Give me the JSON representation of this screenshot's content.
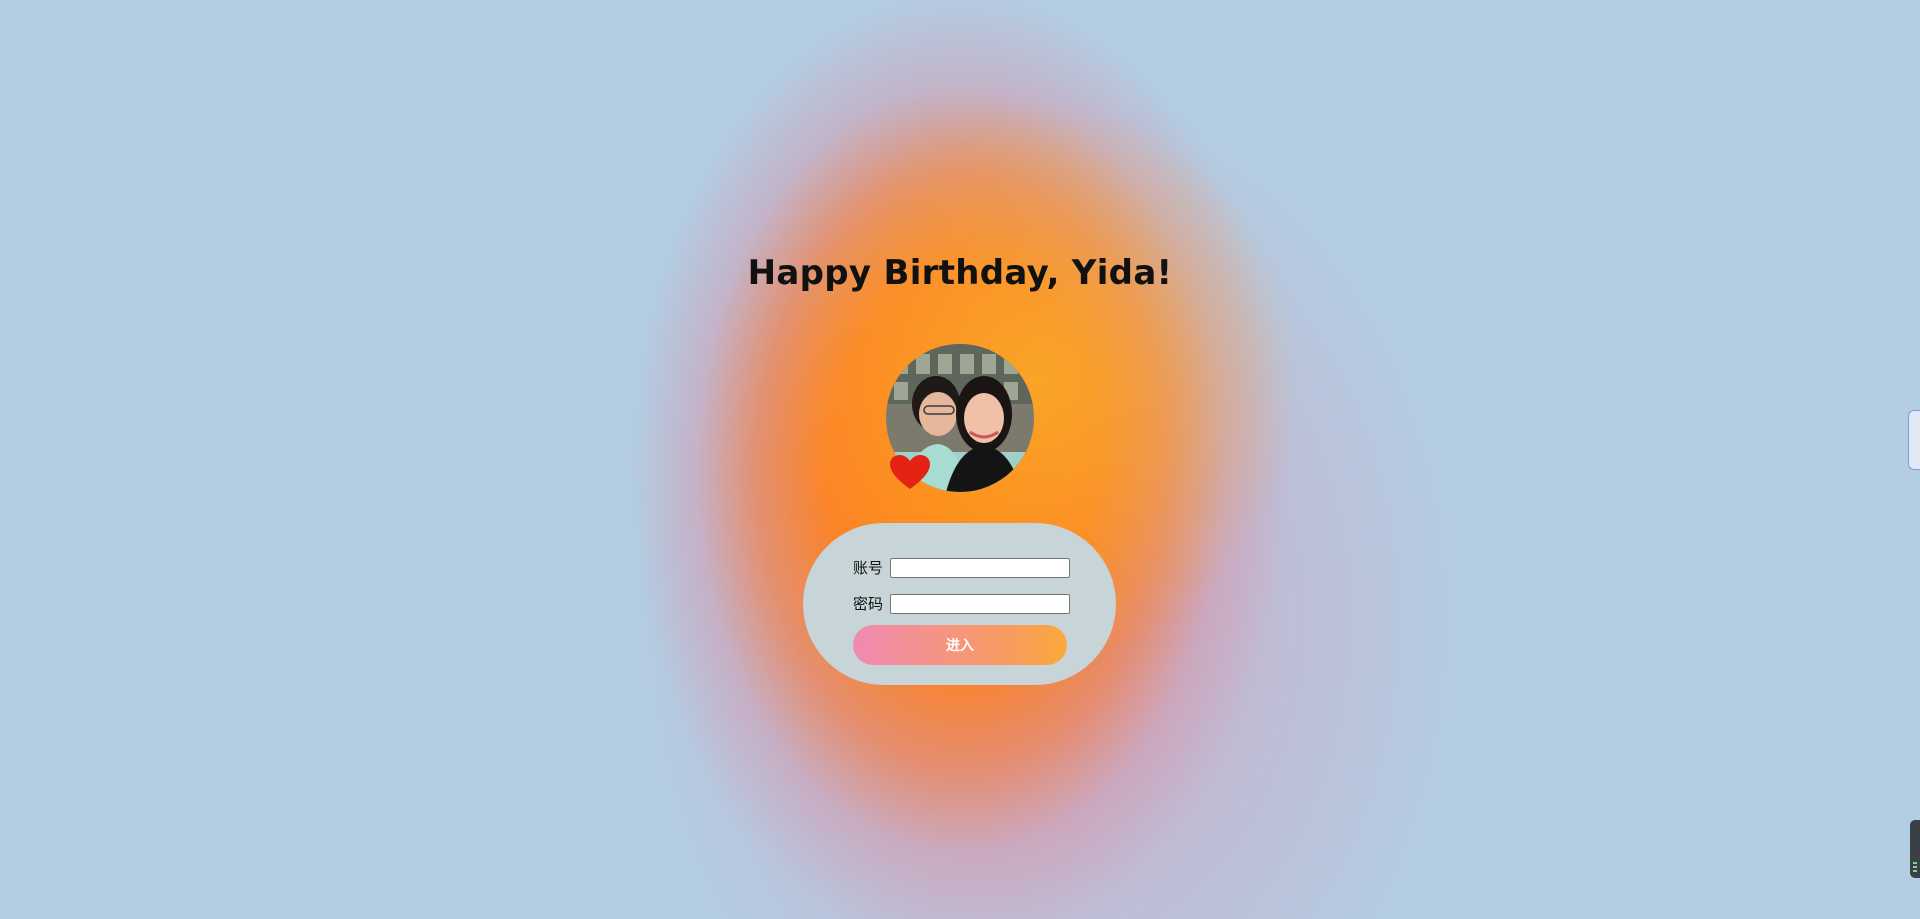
{
  "page": {
    "title": "Happy Birthday, Yida!"
  },
  "avatar": {
    "icon": "couple-photo",
    "badge_icon": "heart-icon",
    "badge_color": "#e32214"
  },
  "login": {
    "account_label": "账号",
    "account_value": "",
    "password_label": "密码",
    "password_value": "",
    "enter_label": "进入"
  },
  "colors": {
    "background": "#b3cde3",
    "glow": "#ff8414",
    "card": "#c8d5d8",
    "button_start": "#ef8ab2",
    "button_end": "#fba93a"
  }
}
